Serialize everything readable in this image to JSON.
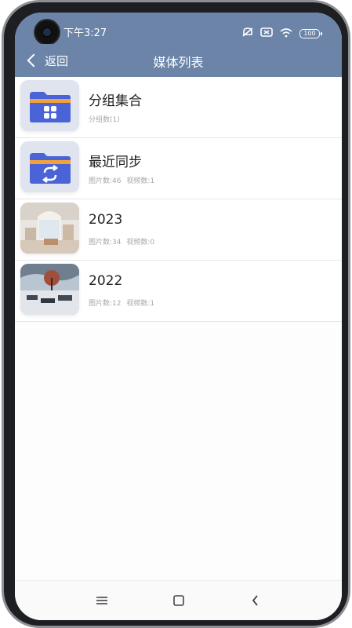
{
  "status_bar": {
    "time": "下午3:27",
    "battery": "100",
    "icons": [
      "silent-icon",
      "sim-off-icon",
      "wifi-icon",
      "battery-icon"
    ]
  },
  "nav": {
    "back_label": "返回",
    "title": "媒体列表"
  },
  "colors": {
    "header": "#6b84a8",
    "folder_blue": "#4a63d6",
    "folder_orange": "#f2a23a"
  },
  "media_list": [
    {
      "title": "分组集合",
      "sub1": "分组数(1)",
      "sub2": "",
      "thumb": "group-folder-icon"
    },
    {
      "title": "最近同步",
      "sub1": "图片数:46",
      "sub2": "视频数:1",
      "thumb": "sync-folder-icon"
    },
    {
      "title": "2023",
      "sub1": "图片数:34",
      "sub2": "视频数:0",
      "thumb": "room-photo-thumbnail"
    },
    {
      "title": "2022",
      "sub1": "图片数:12",
      "sub2": "视频数:1",
      "thumb": "landscape-photo-thumbnail"
    }
  ],
  "bottom_nav": [
    "menu-icon",
    "home-icon",
    "back-icon"
  ]
}
